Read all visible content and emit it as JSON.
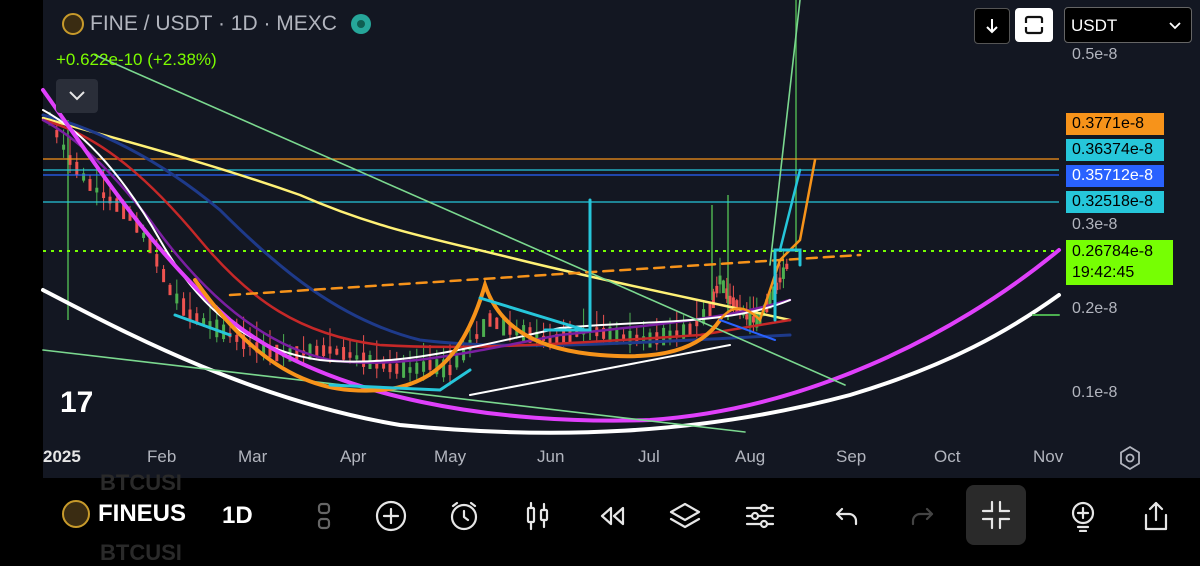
{
  "header": {
    "symbol_title": "FINE / USDT · 1D · MEXC",
    "change_text": "+0.622e-10 (+2.38%)",
    "currency_select": "USDT"
  },
  "price_axis": {
    "ticks": [
      "0.5e-8",
      "0.3e-8",
      "0.2e-8",
      "0.1e-8"
    ],
    "labels": [
      {
        "text": "0.3771e-8",
        "color": "#f7931a"
      },
      {
        "text": "0.36374e-8",
        "color": "#26c6da"
      },
      {
        "text": "0.35712e-8",
        "color": "#2962ff"
      },
      {
        "text": "0.32518e-8",
        "color": "#26c6da"
      },
      {
        "text": "0.26784e-8",
        "color": "#76ff03"
      }
    ],
    "countdown": "19:42:45"
  },
  "time_axis": {
    "labels": [
      "2025",
      "Feb",
      "Mar",
      "Apr",
      "May",
      "Jun",
      "Jul",
      "Aug",
      "Sep",
      "Oct",
      "Nov"
    ]
  },
  "bottom_toolbar": {
    "symbol": "FINEUS",
    "interval": "1D",
    "ghost_top": "BTCUSI",
    "ghost_bottom": "BTCUSI",
    "icons": [
      "more-vertical-icon",
      "add-indicator-icon",
      "alert-clock-icon",
      "candles-icon",
      "replay-icon",
      "layers-icon",
      "settings-sliders-icon",
      "undo-icon",
      "redo-icon",
      "collapse-icon",
      "hint-bulb-icon",
      "share-icon"
    ]
  },
  "colors": {
    "background": "#131722",
    "up": "#26a69a",
    "bull_green": "#4caf50",
    "orange": "#f7931a",
    "cyan": "#26c6da",
    "blue": "#2962ff",
    "lime": "#76ff03",
    "magenta": "#e040fb",
    "yellow": "#fff176"
  }
}
